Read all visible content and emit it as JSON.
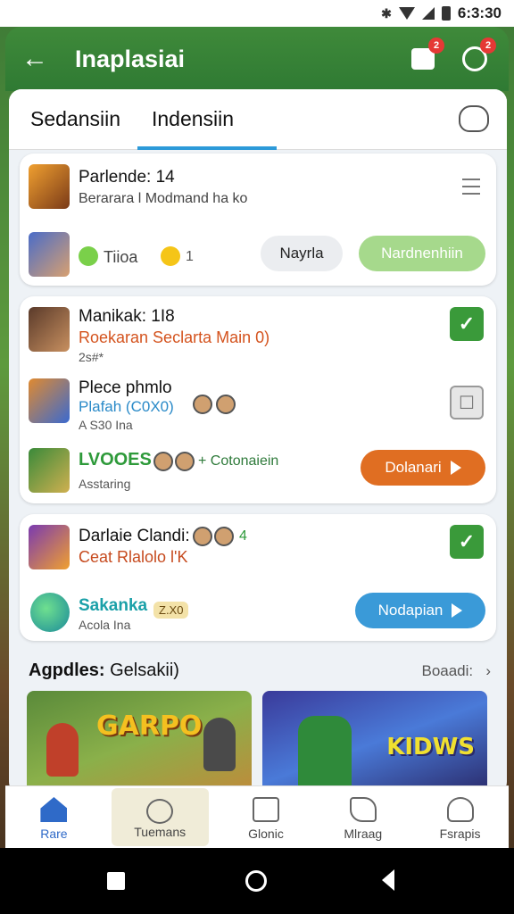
{
  "status_bar": {
    "time": "6:3:30"
  },
  "app_bar": {
    "title": "Inaplasiai",
    "badge_puzzle": "2",
    "badge_ring": "2"
  },
  "tabs": [
    {
      "label": "Sedansiin"
    },
    {
      "label": "Indensiin"
    }
  ],
  "card1": {
    "title": "Parlende: 14",
    "subtitle": "Berarara l Modmand ha ko",
    "meta_text": "Tiioa",
    "meta_count": "1",
    "btn_secondary": "Nayrla",
    "btn_primary": "Nardnenhiin"
  },
  "card2": {
    "row1_title": "Manikak: 1I8",
    "row1_sub": "Roekaran Seclarta Main 0)",
    "row1_small": "2s#*",
    "row2_title": "Plece phmlo",
    "row2_sub": "Plafah (C0X0)",
    "row2_small": "A S30 Ina",
    "row3_title": "LVOOES",
    "row3_meta": "+ Cotonaiein",
    "row3_small": "Asstaring",
    "row3_button": "Dolanari"
  },
  "card3": {
    "row1_title": "Darlaie Clandi:",
    "row1_count": "4",
    "row1_sub": "Ceat Rlalolo l'K",
    "row2_title": "Sakanka",
    "row2_chip": "Z.X0",
    "row2_small": "Acola Ina",
    "row2_button": "Nodapian"
  },
  "section": {
    "label_bold": "Agpdles:",
    "label_rest": "Gelsakii)",
    "see_all": "Boaadi:"
  },
  "banners": [
    {
      "text": "GARPO"
    },
    {
      "text": "KIDWS"
    }
  ],
  "bottom_nav": [
    {
      "label": "Rare",
      "icon": "home-icon"
    },
    {
      "label": "Tuemans",
      "icon": "clock-icon"
    },
    {
      "label": "Glonic",
      "icon": "calendar-icon"
    },
    {
      "label": "Mlraag",
      "icon": "shape-icon"
    },
    {
      "label": "Fsrapis",
      "icon": "user-icon"
    }
  ],
  "colors": {
    "app_bar": "#3f8a3a",
    "accent_blue": "#2d9ad9",
    "button_orange": "#e06e22",
    "button_blue": "#3a9ad8",
    "button_green_light": "#a6d98c",
    "check_green": "#3a9a3a"
  }
}
